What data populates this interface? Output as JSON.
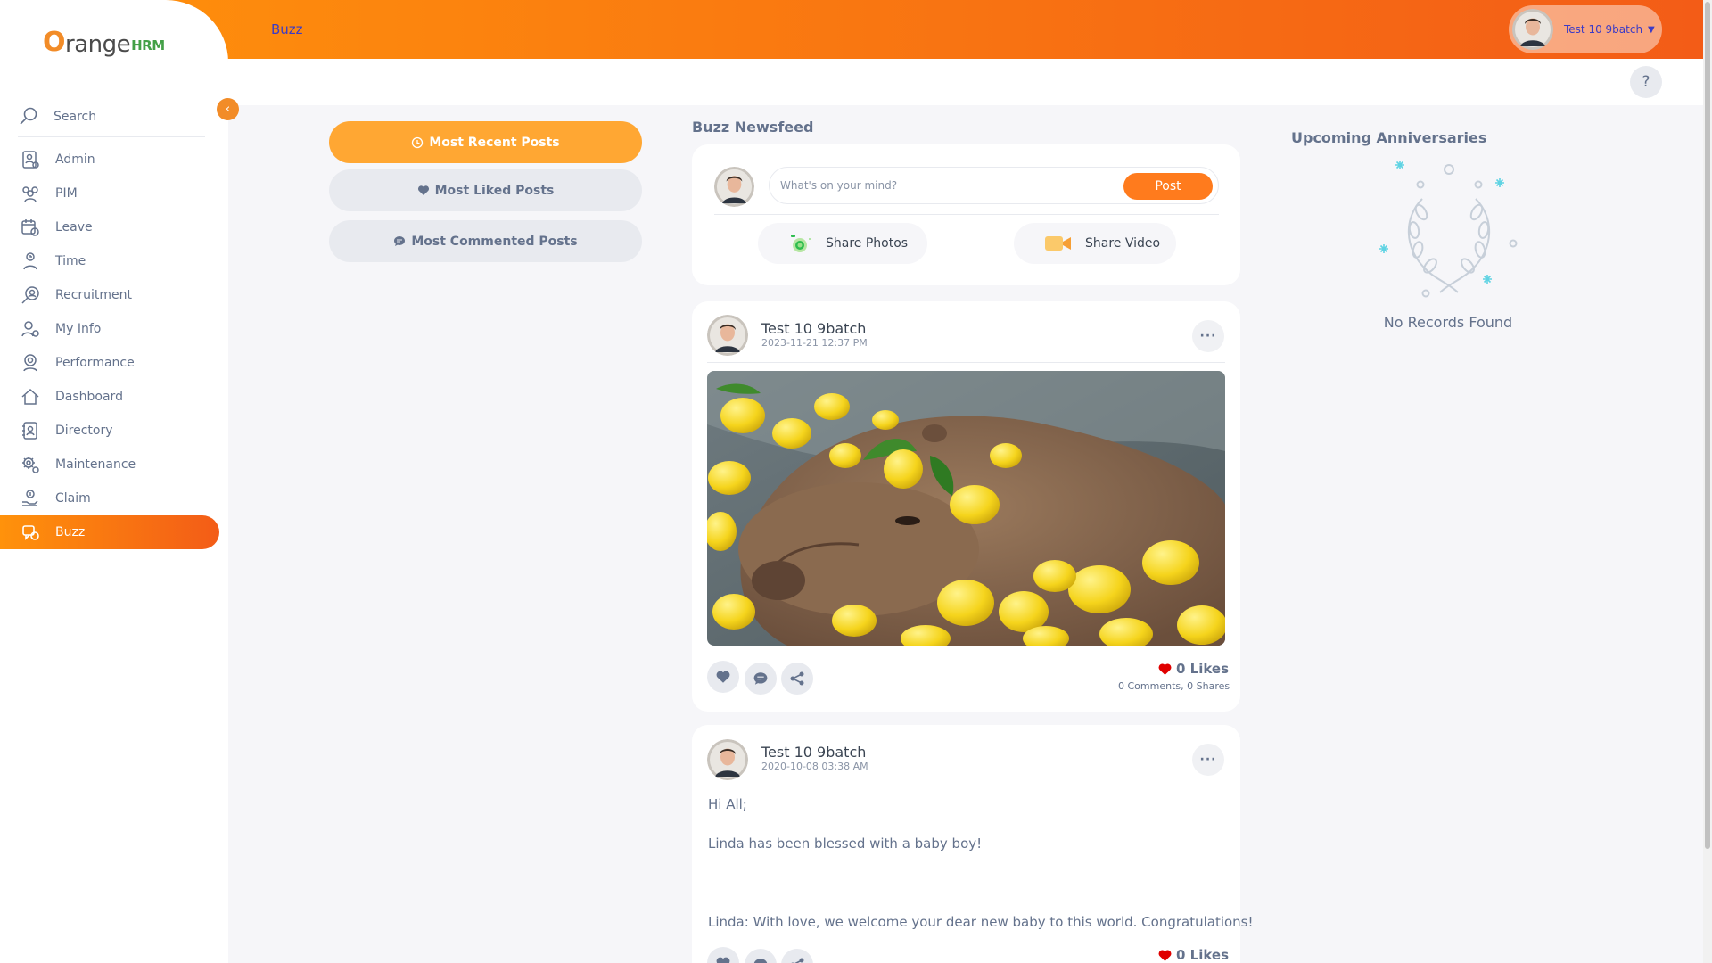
{
  "app": {
    "logo_o": "O",
    "logo_text": "range",
    "logo_hrm": "HRM"
  },
  "topbar": {
    "title": "Buzz",
    "user_name": "Test 10 9batch",
    "help_label": "?"
  },
  "sidebar": {
    "search_label": "Search",
    "items": [
      {
        "label": "Admin",
        "icon": "admin-icon"
      },
      {
        "label": "PIM",
        "icon": "pim-icon"
      },
      {
        "label": "Leave",
        "icon": "leave-icon"
      },
      {
        "label": "Time",
        "icon": "time-icon"
      },
      {
        "label": "Recruitment",
        "icon": "recruitment-icon"
      },
      {
        "label": "My Info",
        "icon": "my-info-icon"
      },
      {
        "label": "Performance",
        "icon": "performance-icon"
      },
      {
        "label": "Dashboard",
        "icon": "dashboard-icon"
      },
      {
        "label": "Directory",
        "icon": "directory-icon"
      },
      {
        "label": "Maintenance",
        "icon": "maintenance-icon"
      },
      {
        "label": "Claim",
        "icon": "claim-icon"
      },
      {
        "label": "Buzz",
        "icon": "buzz-icon",
        "active": true
      }
    ]
  },
  "filters": {
    "most_recent": "Most Recent Posts",
    "most_liked": "Most Liked Posts",
    "most_commented": "Most Commented Posts"
  },
  "newsfeed": {
    "title": "Buzz Newsfeed",
    "composer_placeholder": "What's on your mind?",
    "post_button": "Post",
    "share_photos": "Share Photos",
    "share_video": "Share Video"
  },
  "posts": [
    {
      "author": "Test 10 9batch",
      "date": "2023-11-21 12:37 PM",
      "likes": "0 Likes",
      "comments": "0 Comments",
      "shares": "0 Shares",
      "image_subject": "capybara bathing with yuzu citrus fruits"
    },
    {
      "author": "Test 10 9batch",
      "date": "2020-10-08 03:38 AM",
      "lines": [
        "Hi All;",
        "Linda has been blessed with a baby boy!",
        "Linda: With love, we welcome your dear new baby to this world. Congratulations!"
      ],
      "likes": "0 Likes"
    }
  ],
  "anniversaries": {
    "title": "Upcoming Anniversaries",
    "empty": "No Records Found"
  },
  "colors": {
    "brand_orange": "#ff7b1d",
    "gradient_start": "#ff920b",
    "gradient_end": "#f35c17",
    "text_muted": "#64728c",
    "like_red": "#e00000"
  }
}
